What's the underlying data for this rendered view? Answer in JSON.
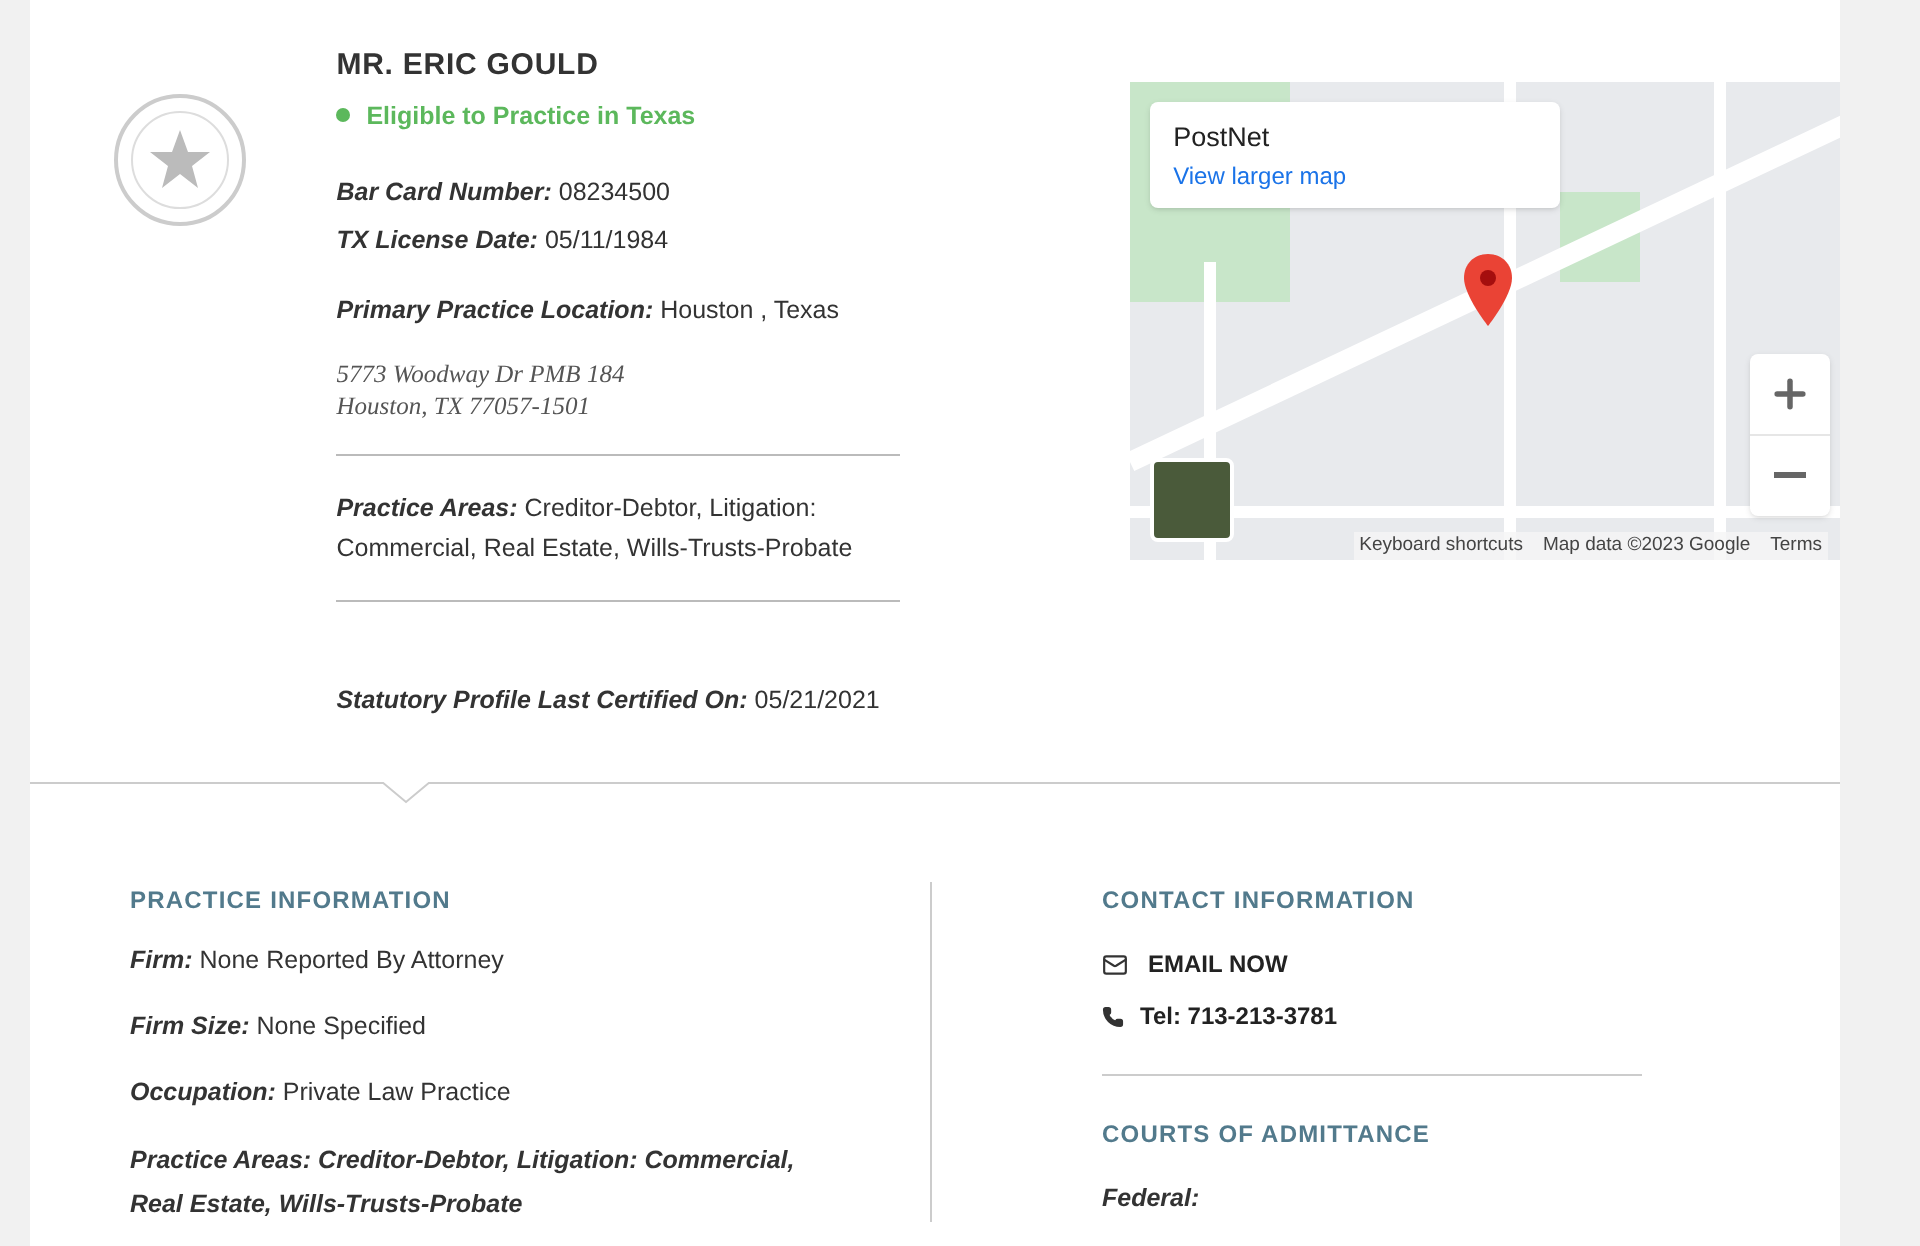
{
  "profile": {
    "name": "MR. ERIC GOULD",
    "status": {
      "label": "Eligible to Practice in Texas",
      "eligible": true
    },
    "fields": [
      {
        "label": "Bar Card Number:",
        "value": "08234500"
      },
      {
        "label": "TX License Date:",
        "value": "05/11/1984"
      }
    ],
    "primary_location": {
      "label": "Primary Practice Location:",
      "value": "Houston , Texas"
    },
    "address": [
      "5773 Woodway Dr PMB 184",
      "Houston, TX 77057-1501"
    ],
    "practice_areas": {
      "label": "Practice Areas:",
      "value": "Creditor-Debtor, Litigation: Commercial, Real Estate, Wills-Trusts-Probate"
    },
    "certified": {
      "label": "Statutory Profile Last Certified On:",
      "value": "05/21/2021"
    }
  },
  "map": {
    "place_card": {
      "title": "PostNet",
      "link": "View larger map"
    },
    "footer": [
      "Keyboard shortcuts",
      "Map data ©2023 Google",
      "Terms"
    ]
  },
  "practice_information": {
    "heading": "PRACTICE INFORMATION",
    "fields": [
      {
        "label": "Firm:",
        "value": "None Reported By Attorney"
      },
      {
        "label": "Firm Size:",
        "value": "None Specified"
      },
      {
        "label": "Occupation:",
        "value": "Private Law Practice"
      }
    ],
    "practice_areas": "Practice Areas: Creditor-Debtor, Litigation: Commercial, Real Estate, Wills-Trusts-Probate"
  },
  "contact_information": {
    "heading": "CONTACT INFORMATION",
    "email": "EMAIL NOW",
    "phone": "Tel: 713-213-3781"
  },
  "courts": {
    "heading": "COURTS OF ADMITTANCE",
    "items": [
      "Federal:"
    ]
  }
}
